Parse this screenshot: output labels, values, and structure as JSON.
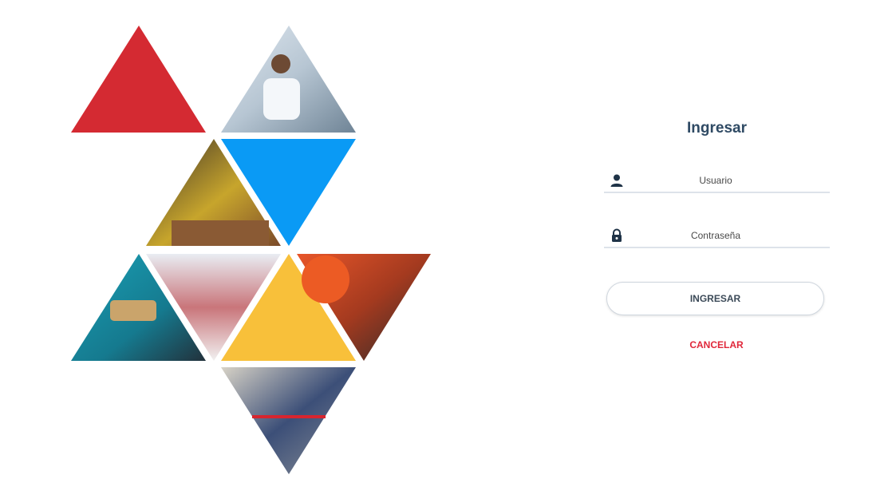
{
  "login": {
    "title": "Ingresar",
    "username_placeholder": "Usuario",
    "username_value": "",
    "password_placeholder": "Contraseña",
    "password_value": "",
    "submit_label": "INGRESAR",
    "cancel_label": "CANCELAR"
  },
  "icons": {
    "username": "user-icon",
    "password": "lock-icon"
  },
  "colors": {
    "red": "#d42a32",
    "blue": "#0a9af5",
    "yellow": "#f8c03a",
    "title": "#2f4a64",
    "cancel": "#e0273a"
  }
}
